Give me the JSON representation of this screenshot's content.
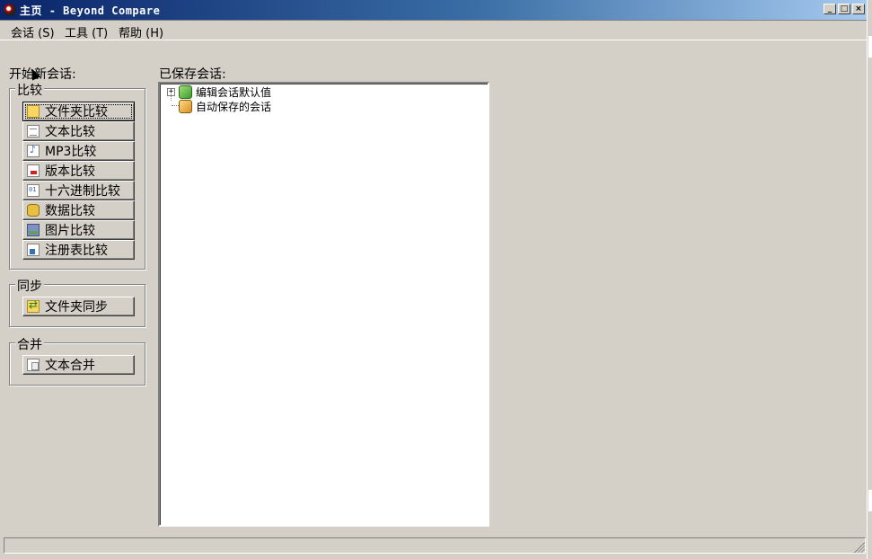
{
  "window": {
    "title": "主页 - Beyond Compare",
    "buttons": {
      "minimize": "_",
      "maximize": "□",
      "close": "×"
    }
  },
  "menu": [
    {
      "label": "会话 (S)"
    },
    {
      "label": "工具 (T)"
    },
    {
      "label": "帮助 (H)"
    }
  ],
  "new_session": {
    "heading": "开始新会话:",
    "compare": {
      "title": "比较",
      "buttons": [
        {
          "label": "文件夹比较",
          "icon": "folder-icon"
        },
        {
          "label": "文本比较",
          "icon": "text-doc-icon"
        },
        {
          "label": "MP3比较",
          "icon": "mp3-icon"
        },
        {
          "label": "版本比较",
          "icon": "version-icon"
        },
        {
          "label": "十六进制比较",
          "icon": "hex-icon"
        },
        {
          "label": "数据比较",
          "icon": "database-icon"
        },
        {
          "label": "图片比较",
          "icon": "picture-icon"
        },
        {
          "label": "注册表比较",
          "icon": "registry-icon"
        }
      ]
    },
    "sync": {
      "title": "同步",
      "button": "文件夹同步"
    },
    "merge": {
      "title": "合并",
      "button": "文本合并"
    }
  },
  "saved_sessions": {
    "heading": "已保存会话:",
    "items": [
      {
        "label": "编辑会话默认值",
        "expander": "+",
        "icon": "green-cube-icon"
      },
      {
        "label": "自动保存的会话",
        "icon": "orange-cube-icon"
      }
    ]
  },
  "status": {
    "text": ""
  }
}
